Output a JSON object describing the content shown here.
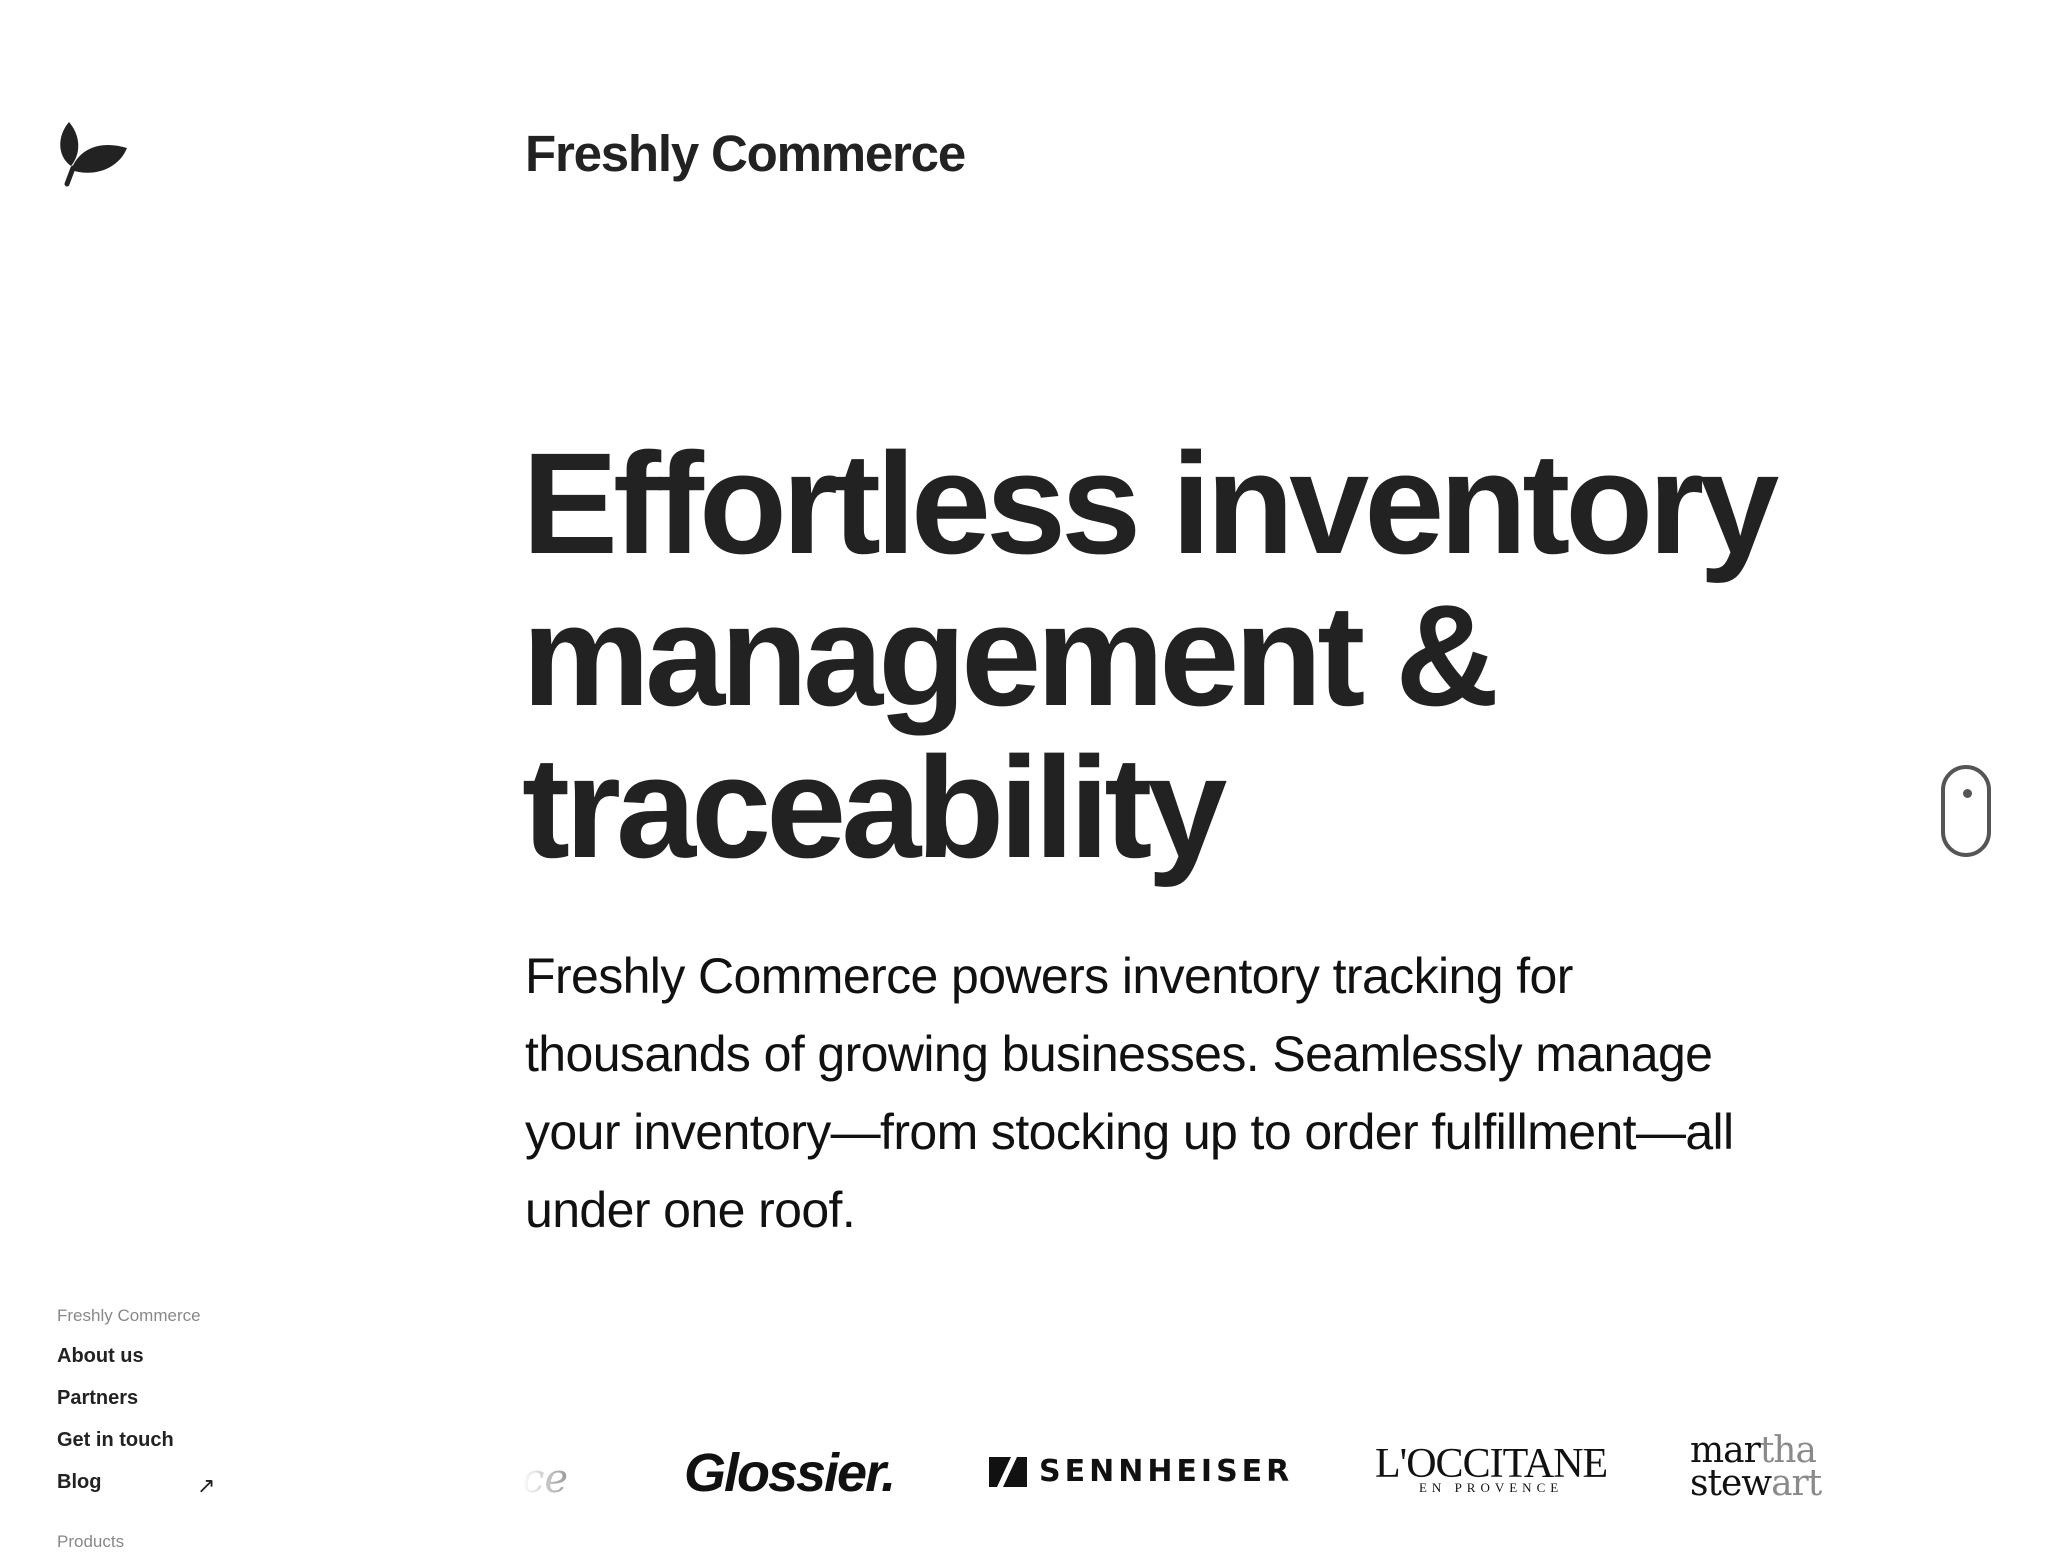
{
  "header": {
    "logo_icon": "leaf-icon",
    "brand_name": "Freshly Commerce"
  },
  "hero": {
    "headline_lines": [
      "Effortless inventory",
      "management &",
      "traceability"
    ],
    "lead_lines": [
      "Freshly Commerce powers inventory tracking for",
      "thousands of growing businesses. Seamlessly manage",
      "your inventory—from stocking up to order fulfillment—all",
      "under one roof."
    ]
  },
  "scroll_indicator": {
    "icon": "mouse-scroll-icon"
  },
  "footer_nav": {
    "section_label": "Freshly Commerce",
    "links": [
      "About us",
      "Partners",
      "Get in touch",
      "Blog"
    ],
    "blog_external_icon": "↗",
    "next_section_label": "Products"
  },
  "customer_logos": {
    "partial": "ce",
    "glossier": "Glossier.",
    "sennheiser": "SENNHEISER",
    "loccitane_main": "L'OCCITANE",
    "loccitane_sub": "EN PROVENCE",
    "martha_line1_a": "mar",
    "martha_line1_b": "tha",
    "martha_line2_a": "stew",
    "martha_line2_b": "art"
  },
  "colors": {
    "text": "#222222",
    "muted": "#888888",
    "background": "#ffffff"
  }
}
